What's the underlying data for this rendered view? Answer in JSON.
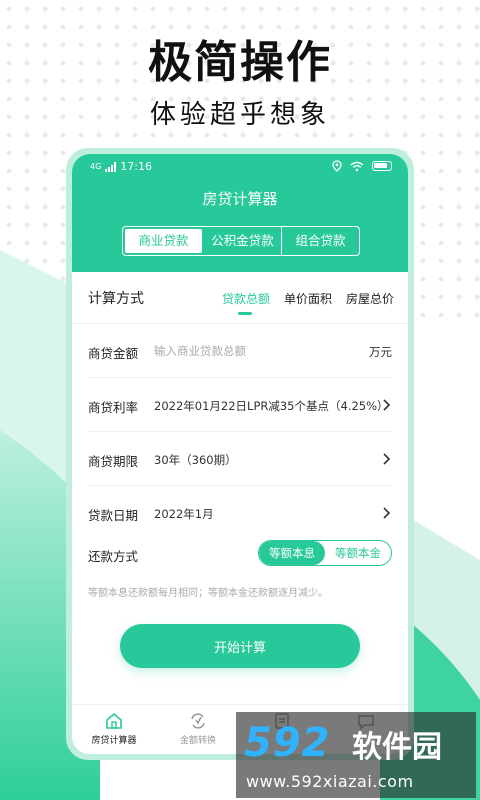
{
  "hero": {
    "title": "极简操作",
    "subtitle": "体验超乎想象"
  },
  "status_bar": {
    "network": "4G",
    "time": "17:16"
  },
  "app": {
    "title": "房贷计算器",
    "loan_tabs": [
      {
        "label": "商业贷款",
        "active": true
      },
      {
        "label": "公积金贷款",
        "active": false
      },
      {
        "label": "组合贷款",
        "active": false
      }
    ]
  },
  "calc_method": {
    "label": "计算方式",
    "options": [
      {
        "label": "贷款总额",
        "active": true
      },
      {
        "label": "单价面积",
        "active": false
      },
      {
        "label": "房屋总价",
        "active": false
      }
    ]
  },
  "form": {
    "amount": {
      "label": "商贷金额",
      "placeholder": "输入商业贷款总额",
      "value": "",
      "unit": "万元"
    },
    "rate": {
      "label": "商贷利率",
      "value": "2022年01月22日LPR减35个基点（4.25%）"
    },
    "term": {
      "label": "商贷期限",
      "value": "30年（360期）"
    },
    "date": {
      "label": "贷款日期",
      "value": "2022年1月"
    }
  },
  "repayment": {
    "label": "还款方式",
    "options": [
      {
        "label": "等额本息",
        "active": true
      },
      {
        "label": "等额本金",
        "active": false
      }
    ],
    "note": "等额本息还款额每月相同；等额本金还款额逐月减少。"
  },
  "start_button": {
    "label": "开始计算"
  },
  "bottom_nav": [
    {
      "label": "房贷计算器",
      "icon": "house-icon",
      "active": true
    },
    {
      "label": "金额转换",
      "icon": "exchange-icon",
      "active": false
    },
    {
      "label": "",
      "icon": "document-icon",
      "active": false
    },
    {
      "label": "",
      "icon": "chat-icon",
      "active": false
    }
  ],
  "watermark": {
    "logo": "592",
    "brand": "软件园",
    "url": "www.592xiazai.com"
  },
  "colors": {
    "accent": "#27c99b",
    "phone_frame": "#bfeedd",
    "text": "#222222",
    "muted": "#aaaaaa"
  }
}
